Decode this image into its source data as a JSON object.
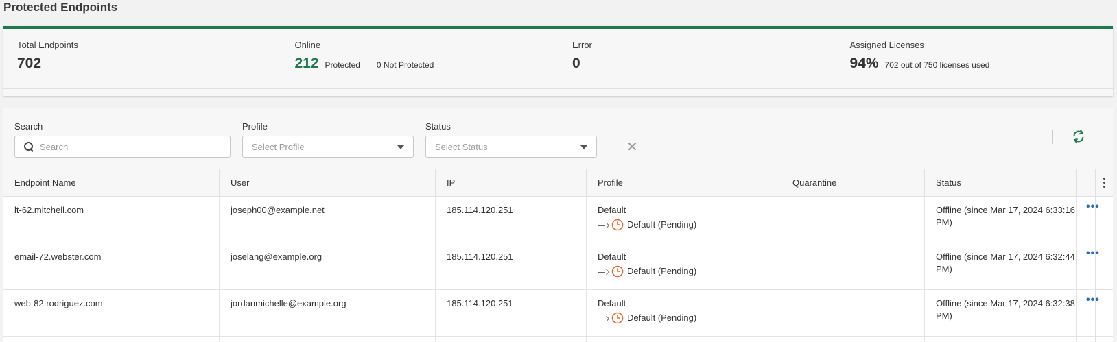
{
  "page": {
    "title": "Protected Endpoints"
  },
  "stats": {
    "total": {
      "label": "Total Endpoints",
      "value": "702"
    },
    "online": {
      "label": "Online",
      "value": "212",
      "protected_label": "Protected",
      "not_protected": "0 Not Protected"
    },
    "error": {
      "label": "Error",
      "value": "0"
    },
    "licenses": {
      "label": "Assigned Licenses",
      "value": "94%",
      "detail": "702 out of 750 licenses used"
    }
  },
  "filters": {
    "search": {
      "label": "Search",
      "placeholder": "Search"
    },
    "profile": {
      "label": "Profile",
      "placeholder": "Select Profile"
    },
    "status": {
      "label": "Status",
      "placeholder": "Select Status"
    },
    "clear_icon": "close-icon",
    "refresh_icon": "refresh-icon"
  },
  "table": {
    "columns": [
      "Endpoint Name",
      "User",
      "IP",
      "Profile",
      "Quarantine",
      "Status"
    ],
    "rows": [
      {
        "name": "lt-62.mitchell.com",
        "user": "joseph00@example.net",
        "ip": "185.114.120.251",
        "profile": "Default",
        "pending": "Default (Pending)",
        "quarantine": "",
        "status": "Offline (since Mar 17, 2024 6:33:16 PM)"
      },
      {
        "name": "email-72.webster.com",
        "user": "joselang@example.org",
        "ip": "185.114.120.251",
        "profile": "Default",
        "pending": "Default (Pending)",
        "quarantine": "",
        "status": "Offline (since Mar 17, 2024 6:32:44 PM)"
      },
      {
        "name": "web-82.rodriguez.com",
        "user": "jordanmichelle@example.org",
        "ip": "185.114.120.251",
        "profile": "Default",
        "pending": "Default (Pending)",
        "quarantine": "",
        "status": "Offline (since Mar 17, 2024 6:32:38 PM)"
      }
    ]
  },
  "colors": {
    "accent": "#1e7a4e",
    "pending": "#e8692c",
    "link": "#2d6ab1"
  }
}
